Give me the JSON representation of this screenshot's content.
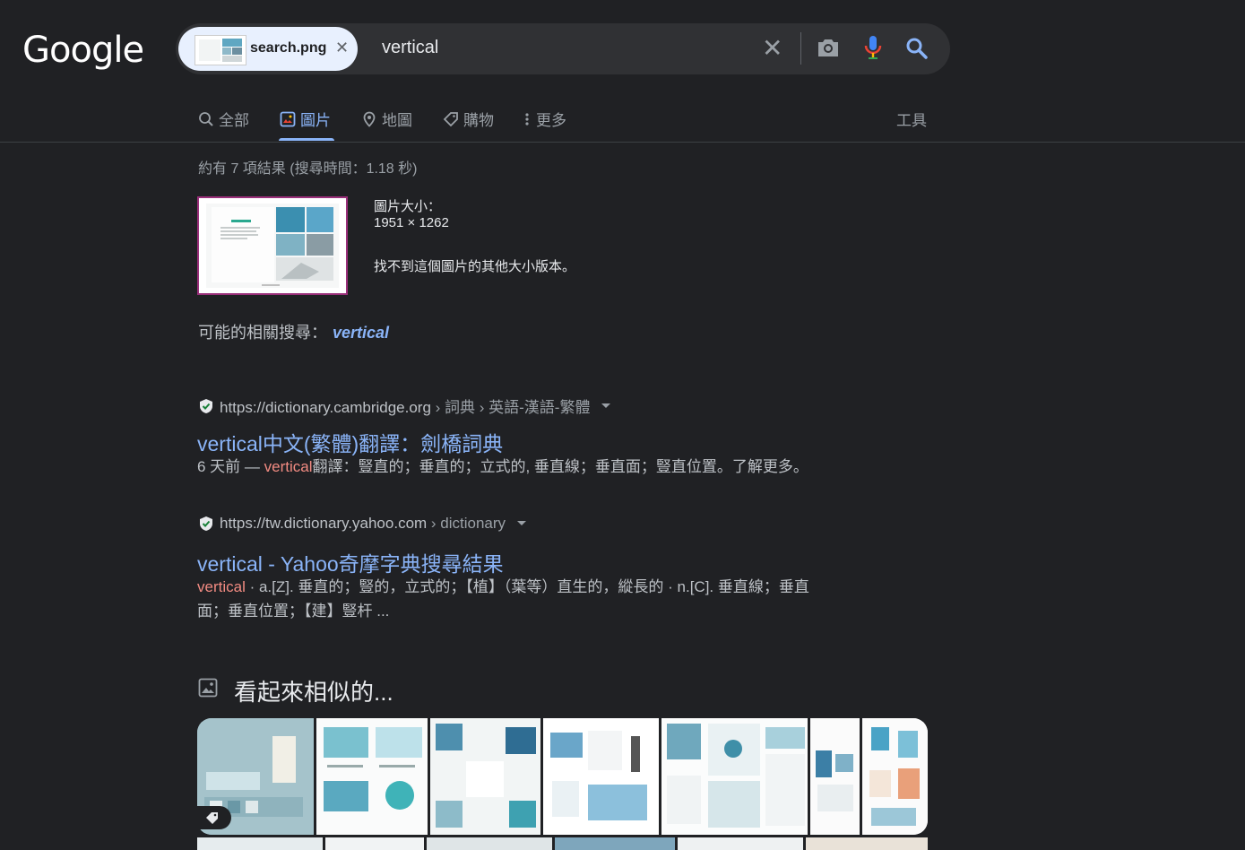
{
  "header": {
    "logo": "Google",
    "chip_file": "search.png",
    "query": "vertical"
  },
  "tabs": [
    {
      "label": "全部",
      "icon": "search-icon"
    },
    {
      "label": "圖片",
      "icon": "image-icon",
      "active": true
    },
    {
      "label": "地圖",
      "icon": "map-pin-icon"
    },
    {
      "label": "購物",
      "icon": "tag-icon"
    },
    {
      "label": "更多",
      "icon": "more-vert-icon"
    }
  ],
  "tools_label": "工具",
  "stats": "約有 7 項結果 (搜尋時間：1.18 秒)",
  "image_info": {
    "size_label": "圖片大小：",
    "size_value": "1951 × 1262",
    "no_other": "找不到這個圖片的其他大小版本。"
  },
  "related": {
    "label": "可能的相關搜尋：",
    "term": "vertical"
  },
  "results": [
    {
      "url": "https://dictionary.cambridge.org",
      "crumbs": " › 詞典 › 英語-漢語-繁體",
      "title": "vertical中文(繁體)翻譯：劍橋詞典",
      "snippet_pre": "6 天前 — ",
      "snippet_hl": "vertical",
      "snippet_post": "翻譯：豎直的；垂直的；立式的, 垂直線；垂直面；豎直位置。了解更多。"
    },
    {
      "url": "https://tw.dictionary.yahoo.com",
      "crumbs": " › dictionary",
      "title": "vertical - Yahoo奇摩字典搜尋結果",
      "snippet_hl": "vertical",
      "snippet_line1": " · a.[Z]. 垂直的；豎的，立式的；【植】（葉等）直生的，縱長的 · n.[C]. 垂直線；垂直",
      "snippet_line2": "面；垂直位置；【建】豎杆 ..."
    }
  ],
  "similar": {
    "title": "看起來相似的..."
  },
  "colors": {
    "background": "#202124",
    "link": "#8ab4f8",
    "highlight": "#f28b82",
    "verified": "#81c995"
  }
}
